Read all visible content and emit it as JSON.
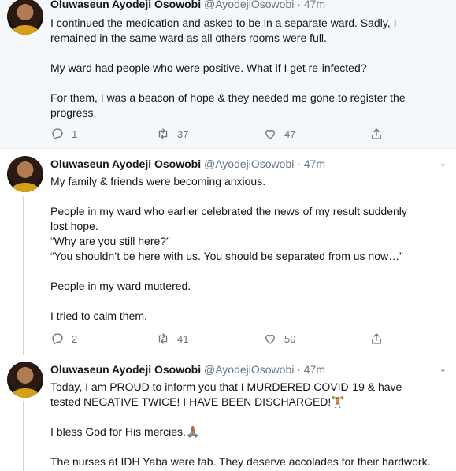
{
  "tweets": [
    {
      "name": "Oluwaseun Ayodeji Osowobi",
      "handle": "@AyodejiOsowobi · 47m",
      "lines": [
        "I continued the medication and asked to be in a separate ward. Sadly, I",
        "remained in the same ward as all others rooms were full.",
        "",
        "My ward had people who were positive. What if I get re-infected?",
        "",
        "For them, I was a beacon of hope & they needed me gone to register the",
        "progress."
      ],
      "replies": "1",
      "retweets": "37",
      "likes": "47"
    },
    {
      "name": "Oluwaseun Ayodeji Osowobi",
      "handle": "@AyodejiOsowobi · 47m",
      "lines": [
        "My family & friends were becoming anxious.",
        "",
        "People in my ward who earlier celebrated the news of my result suddenly",
        "lost hope.",
        "“Why are you still here?”",
        "“You shouldn’t be here with us. You should be separated from us now…”",
        "",
        "People in my ward muttered.",
        "",
        "I tried to calm them."
      ],
      "replies": "2",
      "retweets": "41",
      "likes": "50"
    },
    {
      "name": "Oluwaseun Ayodeji Osowobi",
      "handle": "@AyodejiOsowobi · 47m",
      "lines": [
        "Today, I am PROUD to inform you that I MURDERED COVID-19 & have",
        "tested NEGATIVE TWICE! I HAVE BEEN DISCHARGED!🏋",
        "",
        "I bless God for His mercies.🙏🏽",
        "",
        "The nurses at IDH Yaba were fab. They deserve accolades for their hardwork."
      ]
    }
  ],
  "icons": {
    "reply": "reply-icon",
    "retweet": "retweet-icon",
    "like": "like-icon",
    "share": "share-icon"
  },
  "colors": {
    "highlight_bg": "#f5f8fa",
    "text": "#14171a",
    "muted": "#657786"
  }
}
